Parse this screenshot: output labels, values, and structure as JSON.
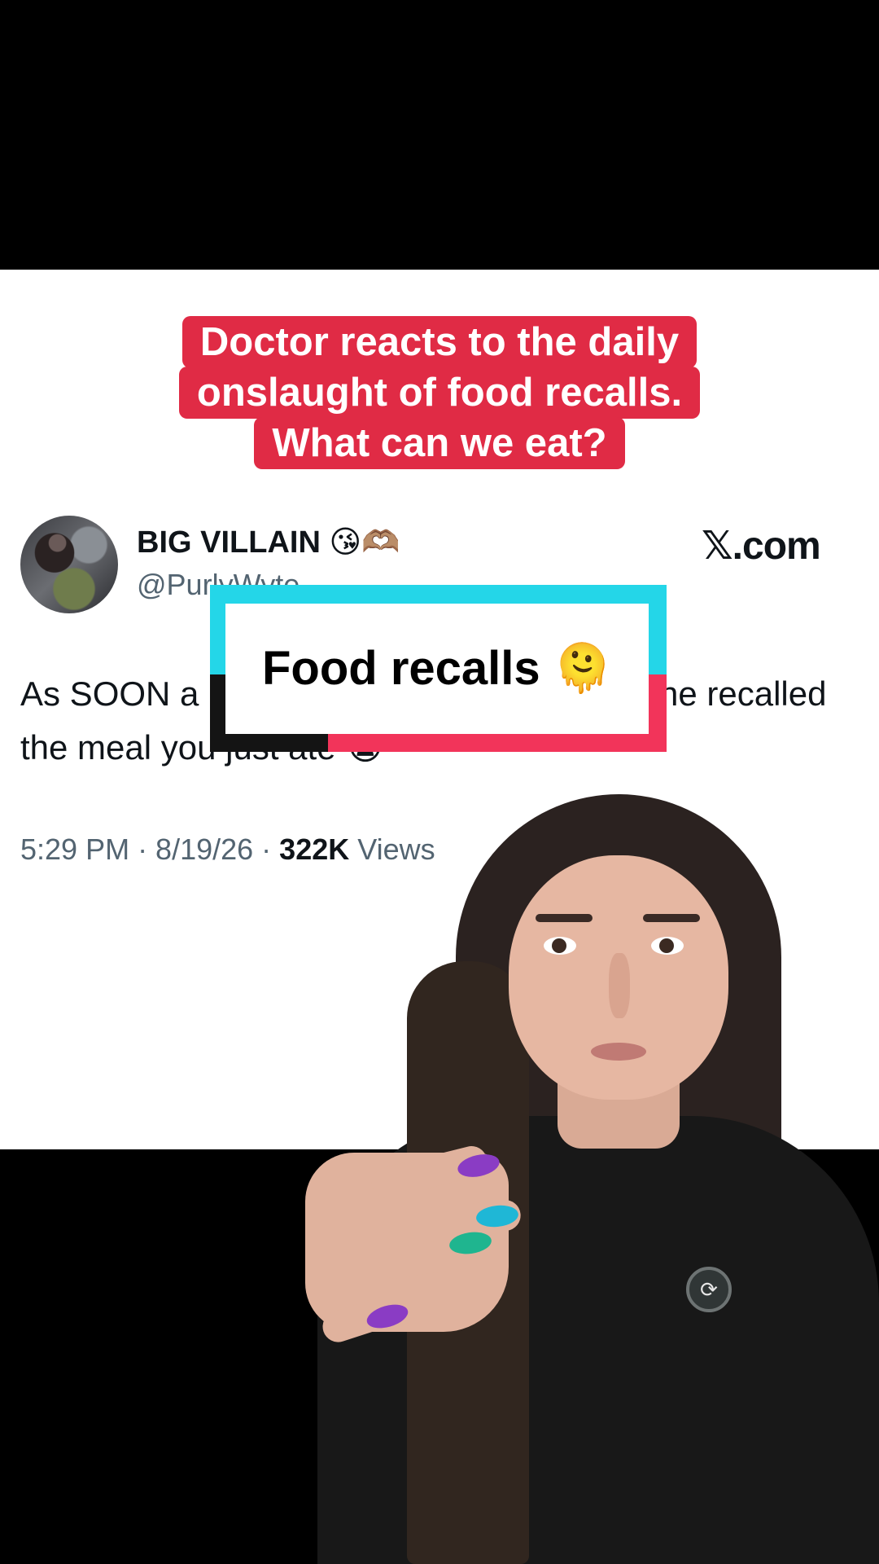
{
  "caption": {
    "lines": [
      "Doctor reacts to the daily",
      "onslaught of food recalls.",
      "What can we eat?"
    ]
  },
  "tweet": {
    "display_name": "BIG VILLAIN 😘🫶🏽",
    "handle": "@PurlyWyte",
    "source_label": "𝕏.com",
    "text_line1_start": "As SOON a",
    "text_line1_end": "ne recalled",
    "text_line2": "the meal you just ate 😭",
    "timestamp": "5:29 PM · 8/19/26 · ",
    "views_count": "322K",
    "views_label": " Views"
  },
  "sticker": {
    "text": "Food recalls 🫠"
  },
  "colors": {
    "caption_red": "#e02b45",
    "sticker_cyan": "#24d6e8",
    "sticker_red": "#f2345a",
    "text_dark": "#0f1419",
    "text_muted": "#536471"
  }
}
